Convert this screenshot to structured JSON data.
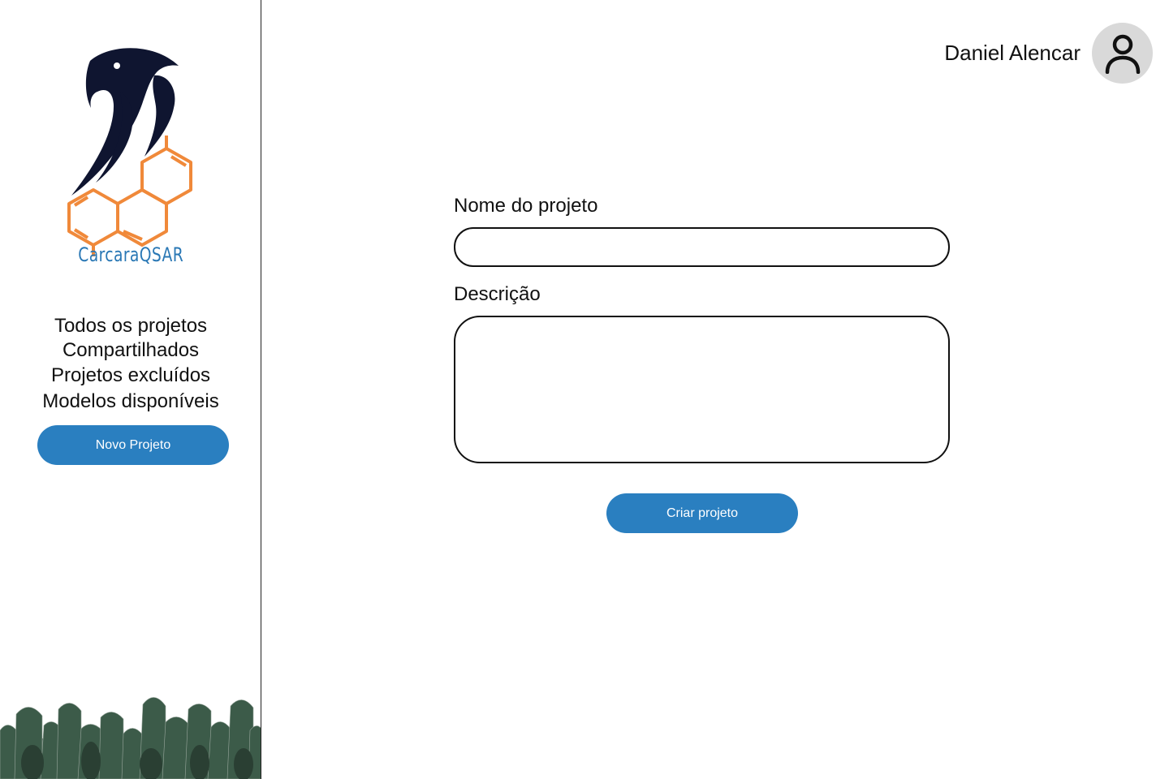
{
  "brand": {
    "name": "CarcaraQSAR",
    "colors": {
      "navy": "#0f1530",
      "orange": "#f0893a",
      "blue": "#2a78b5"
    }
  },
  "sidebar": {
    "nav": [
      {
        "label": "Todos os projetos"
      },
      {
        "label": "Compartilhados"
      },
      {
        "label": "Projetos excluídos"
      },
      {
        "label": "Modelos disponíveis"
      }
    ],
    "new_project_label": "Novo Projeto"
  },
  "user": {
    "name": "Daniel Alencar",
    "avatar_icon": "user-icon"
  },
  "form": {
    "name_label": "Nome do projeto",
    "name_value": "",
    "description_label": "Descrição",
    "description_value": "",
    "submit_label": "Criar projeto"
  },
  "accent_color": "#2a7fc0"
}
